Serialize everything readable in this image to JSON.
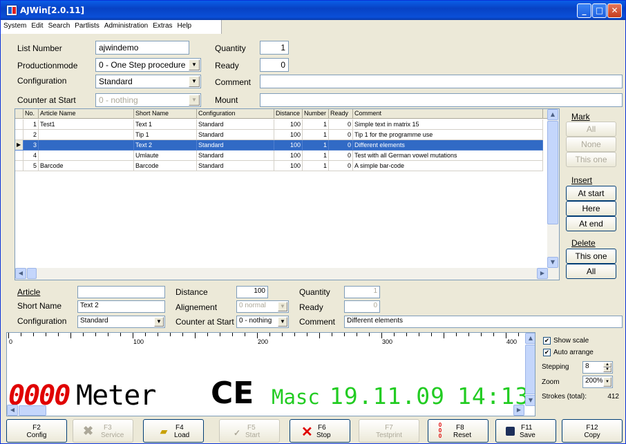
{
  "window": {
    "title": "AJWin[2.0.11]",
    "minimize": "_",
    "maximize": "□",
    "close": "✕"
  },
  "menu": [
    "System",
    "Edit",
    "Search",
    "Partlists",
    "Administration",
    "Extras",
    "Help"
  ],
  "header": {
    "list_number_label": "List Number",
    "list_number": "ajwindemo",
    "productionmode_label": "Productionmode",
    "productionmode": "0 - One Step procedure",
    "configuration_label": "Configuration",
    "configuration": "Standard",
    "counter_label": "Counter at Start",
    "counter": "0 - nothing",
    "quantity_label": "Quantity",
    "quantity": "1",
    "ready_label": "Ready",
    "ready": "0",
    "comment_label": "Comment",
    "comment": "",
    "mount_label": "Mount",
    "mount": ""
  },
  "table": {
    "columns": [
      "No.",
      "Article Name",
      "Short Name",
      "Configuration",
      "Distance",
      "Number",
      "Ready",
      "Comment"
    ],
    "rows": [
      {
        "no": "1",
        "article": "Test1",
        "short": "Text 1",
        "config": "Standard",
        "distance": "100",
        "number": "1",
        "ready": "0",
        "comment": "Simple text in matrix 15"
      },
      {
        "no": "2",
        "article": "",
        "short": "Tip 1",
        "config": "Standard",
        "distance": "100",
        "number": "1",
        "ready": "0",
        "comment": "Tip 1 for the programme use"
      },
      {
        "no": "3",
        "article": "",
        "short": "Text 2",
        "config": "Standard",
        "distance": "100",
        "number": "1",
        "ready": "0",
        "comment": "Different elements"
      },
      {
        "no": "4",
        "article": "",
        "short": "Umlaute",
        "config": "Standard",
        "distance": "100",
        "number": "1",
        "ready": "0",
        "comment": "Test with all German vowel mutations"
      },
      {
        "no": "5",
        "article": "Barcode",
        "short": "Barcode",
        "config": "Standard",
        "distance": "100",
        "number": "1",
        "ready": "0",
        "comment": "A simple bar-code"
      }
    ]
  },
  "side": {
    "mark": "Mark",
    "all": "All",
    "none": "None",
    "this_one": "This one",
    "insert": "Insert",
    "at_start": "At start",
    "here": "Here",
    "at_end": "At end",
    "delete": "Delete",
    "del_this_one": "This one",
    "del_all": "All"
  },
  "detail": {
    "article_label": "Article",
    "article": "",
    "short_label": "Short Name",
    "short": "Text 2",
    "config_label": "Configuration",
    "config": "Standard",
    "distance_label": "Distance",
    "distance": "100",
    "align_label": "Alignement",
    "align": "0 normal",
    "counter_label": "Counter at Start",
    "counter": "0 - nothing",
    "quantity_label": "Quantity",
    "quantity": "1",
    "ready_label": "Ready",
    "ready": "0",
    "comment_label": "Comment",
    "comment": "Different elements"
  },
  "preview": {
    "ruler": [
      "0",
      "100",
      "200",
      "300",
      "400"
    ],
    "counter": "0000",
    "meter": "Meter",
    "ce": "CE",
    "masc": "Masc",
    "date": "19.11.09",
    "time": "14:13",
    "colors": {
      "counter": "#e00000",
      "green": "#22cc22"
    }
  },
  "options": {
    "show_scale": "Show scale",
    "auto_arrange": "Auto arrange",
    "stepping_label": "Stepping",
    "stepping": "8",
    "zoom_label": "Zoom",
    "zoom": "200%",
    "strokes_label": "Strokes (total):",
    "strokes": "412"
  },
  "fkeys": [
    {
      "key": "F2",
      "label": "Config"
    },
    {
      "key": "F3",
      "label": "Service"
    },
    {
      "key": "F4",
      "label": "Load"
    },
    {
      "key": "F5",
      "label": "Start"
    },
    {
      "key": "F6",
      "label": "Stop"
    },
    {
      "key": "F7",
      "label": "Testprint"
    },
    {
      "key": "F8",
      "label": "Reset"
    },
    {
      "key": "F11",
      "label": "Save"
    },
    {
      "key": "F12",
      "label": "Copy"
    }
  ]
}
